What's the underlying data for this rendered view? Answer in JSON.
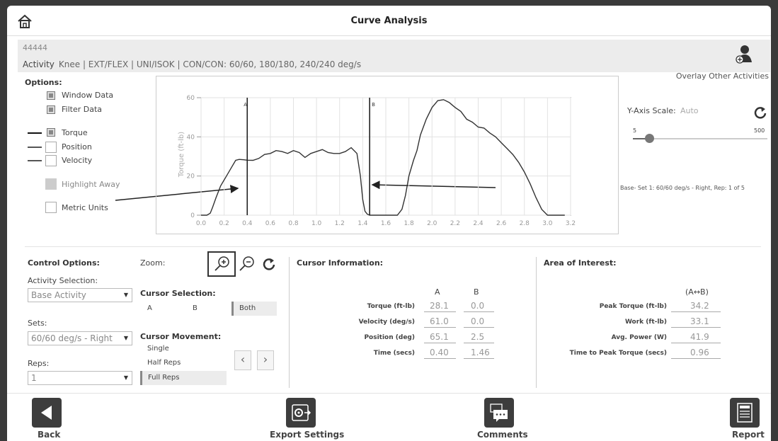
{
  "header": {
    "title": "Curve Analysis"
  },
  "info": {
    "patient_id": "44444",
    "activity_label": "Activity",
    "activity_value": "Knee | EXT/FLEX | UNI/ISOK | CON/CON: 60/60, 180/180, 240/240 deg/s",
    "overlay_label": "Overlay Other Activities"
  },
  "options": {
    "title": "Options:",
    "window_data": "Window Data",
    "filter_data": "Filter Data",
    "torque": "Torque",
    "position": "Position",
    "velocity": "Velocity",
    "highlight_away": "Highlight Away",
    "metric_units": "Metric Units",
    "checked": {
      "window_data": true,
      "filter_data": true,
      "torque": true,
      "position": false,
      "velocity": false,
      "highlight_away": true,
      "metric_units": false
    }
  },
  "chart_data": {
    "type": "line",
    "ylabel": "Torque (ft-lb)",
    "xlim": [
      0.0,
      3.2
    ],
    "ylim": [
      0,
      60
    ],
    "x_ticks": [
      "0.0",
      "0.2",
      "0.4",
      "0.6",
      "0.8",
      "1.0",
      "1.2",
      "1.4",
      "1.6",
      "1.8",
      "2.0",
      "2.2",
      "2.4",
      "2.6",
      "2.8",
      "3.0",
      "3.2"
    ],
    "y_ticks": [
      "0",
      "20",
      "40",
      "60"
    ],
    "cursor_a": {
      "label": "A",
      "x": 0.4
    },
    "cursor_b": {
      "label": "B",
      "x": 1.46
    },
    "grid": true,
    "series": [
      {
        "x": [
          0.0,
          0.05,
          0.08,
          0.1,
          0.13,
          0.17,
          0.22,
          0.27,
          0.3,
          0.33,
          0.37,
          0.4,
          0.45,
          0.5,
          0.55,
          0.6,
          0.65,
          0.7,
          0.75,
          0.8,
          0.85,
          0.9,
          0.95,
          1.0,
          1.05,
          1.1,
          1.15,
          1.2,
          1.25,
          1.3,
          1.35,
          1.38,
          1.4,
          1.42,
          1.44,
          1.46,
          1.6,
          1.7,
          1.74,
          1.77,
          1.8,
          1.84,
          1.87,
          1.9,
          1.95,
          2.0,
          2.05,
          2.1,
          2.15,
          2.2,
          2.25,
          2.3,
          2.35,
          2.4,
          2.45,
          2.5,
          2.55,
          2.6,
          2.65,
          2.7,
          2.75,
          2.8,
          2.85,
          2.9,
          2.95,
          3.0,
          3.03,
          3.05,
          3.1,
          3.15
        ],
        "y": [
          0,
          0,
          1,
          4,
          9,
          15,
          20,
          25,
          28,
          28.5,
          28.3,
          28.1,
          28,
          29,
          31,
          31.5,
          33,
          32.5,
          31.5,
          33,
          32,
          29.5,
          31.5,
          32.5,
          33.5,
          32,
          31.5,
          31.5,
          32.5,
          34.5,
          31.5,
          20,
          8,
          2,
          0.5,
          0,
          0,
          0,
          3,
          10,
          20,
          28,
          33,
          41,
          49,
          55,
          58.5,
          59,
          57.5,
          55,
          53,
          49,
          47.5,
          45,
          44.5,
          42,
          40,
          37,
          34,
          31,
          27,
          22,
          16,
          9,
          3,
          0,
          0,
          0,
          0,
          0
        ]
      }
    ]
  },
  "yscale": {
    "label": "Y-Axis Scale:",
    "value": "Auto",
    "min": "5",
    "max": "500",
    "slider_level": 0.12
  },
  "base_info": "Base- Set 1: 60/60 deg/s - Right, Rep: 1 of 5",
  "control": {
    "title": "Control Options:",
    "activity_selection_label": "Activity Selection:",
    "activity_selection_value": "Base Activity",
    "sets_label": "Sets:",
    "sets_value": "60/60 deg/s - Right",
    "reps_label": "Reps:",
    "reps_value": "1",
    "zoom_label": "Zoom:",
    "cursor_selection_label": "Cursor Selection:",
    "cursor_options": [
      "A",
      "B",
      "Both"
    ],
    "cursor_movement_label": "Cursor Movement:",
    "movement_options": [
      "Single",
      "Half Reps",
      "Full Reps"
    ]
  },
  "cursor_info": {
    "title": "Cursor Information:",
    "col_a": "A",
    "col_b": "B",
    "rows": [
      {
        "label": "Torque (ft-lb)",
        "a": "28.1",
        "b": "0.0"
      },
      {
        "label": "Velocity (deg/s)",
        "a": "61.0",
        "b": "0.0"
      },
      {
        "label": "Position (deg)",
        "a": "65.1",
        "b": "2.5"
      },
      {
        "label": "Time (secs)",
        "a": "0.40",
        "b": "1.46"
      }
    ]
  },
  "area": {
    "title": "Area of Interest:",
    "col": "(A↔B)",
    "rows": [
      {
        "label": "Peak Torque (ft-lb)",
        "value": "34.2"
      },
      {
        "label": "Work (ft-lb)",
        "value": "33.1"
      },
      {
        "label": "Avg. Power (W)",
        "value": "41.9"
      },
      {
        "label": "Time to Peak Torque (secs)",
        "value": "0.96"
      }
    ]
  },
  "bottom": {
    "back": "Back",
    "export": "Export Settings",
    "comments": "Comments",
    "report": "Report"
  }
}
